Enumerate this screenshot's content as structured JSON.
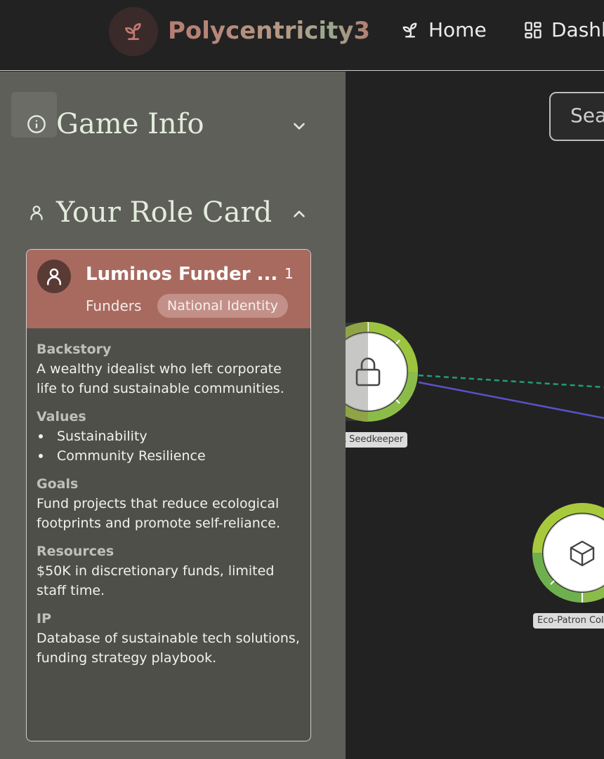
{
  "header": {
    "brand": "Polycentricity3",
    "nav": [
      {
        "label": "Home",
        "icon": "sprout-icon"
      },
      {
        "label": "Dashb",
        "icon": "dashboard-icon"
      }
    ],
    "colors": {
      "brand_start": "#b67c72",
      "brand_end": "#9aaa8f"
    }
  },
  "sidebar": {
    "game_info": {
      "title": "Game Info",
      "icon": "info-icon",
      "expanded": false
    },
    "role_card": {
      "title": "Your Role Card",
      "icon": "user-icon",
      "expanded": true,
      "card": {
        "name": "Luminos Funder ...",
        "number": "1",
        "group": "Funders",
        "badge": "National Identity",
        "backstory_label": "Backstory",
        "backstory": "A wealthy idealist who left corporate life to fund sustainable communities.",
        "values_label": "Values",
        "values": [
          "Sustainability",
          "Community Resilience"
        ],
        "goals_label": "Goals",
        "goals": "Fund projects that reduce ecological footprints and promote self-reliance.",
        "resources_label": "Resources",
        "resources": "$50K in discretionary funds, limited staff time.",
        "ip_label": "IP",
        "ip": "Database of sustainable tech solutions, funding strategy playbook."
      }
    }
  },
  "canvas": {
    "search_placeholder": "Sea",
    "nodes": [
      {
        "label": "PMA Seedkeeper",
        "icon": "lock-icon"
      },
      {
        "label": "Eco-Patron Coll",
        "icon": "cube-icon"
      }
    ],
    "edge_colors": {
      "dashed": "#1f9e78",
      "solid": "#5a52c9"
    },
    "ring_colors": [
      "#a9c93d",
      "#8bbc4a"
    ]
  }
}
